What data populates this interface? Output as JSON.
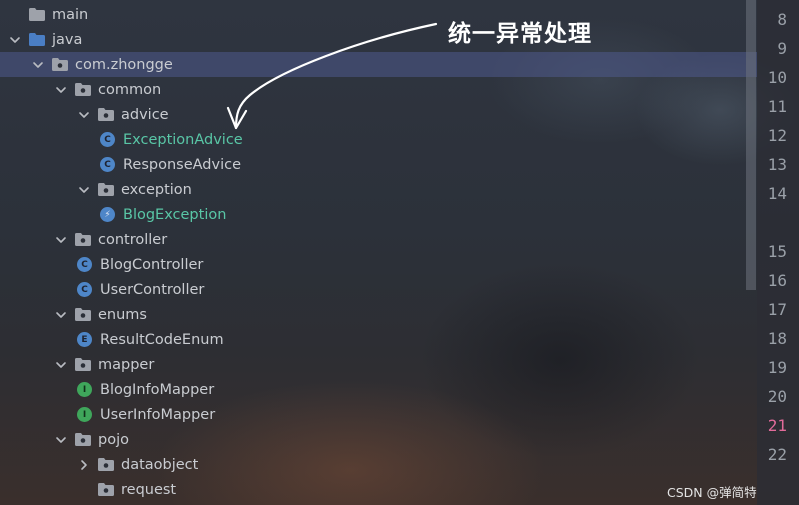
{
  "tree": [
    {
      "label": "main",
      "depth": 0,
      "icon": "folder",
      "arrow": "none",
      "kind": "folder"
    },
    {
      "label": "java",
      "depth": 0,
      "icon": "blue-folder",
      "arrow": "down",
      "kind": "folder"
    },
    {
      "label": "com.zhongge",
      "depth": 1,
      "icon": "package",
      "arrow": "down",
      "kind": "package",
      "selected": true
    },
    {
      "label": "common",
      "depth": 2,
      "icon": "package",
      "arrow": "down",
      "kind": "package"
    },
    {
      "label": "advice",
      "depth": 3,
      "icon": "package",
      "arrow": "down",
      "kind": "package"
    },
    {
      "label": "ExceptionAdvice",
      "depth": 4,
      "icon": "class",
      "kind": "class",
      "green": true
    },
    {
      "label": "ResponseAdvice",
      "depth": 4,
      "icon": "class",
      "kind": "class"
    },
    {
      "label": "exception",
      "depth": 3,
      "icon": "package",
      "arrow": "down",
      "kind": "package"
    },
    {
      "label": "BlogException",
      "depth": 4,
      "icon": "exception",
      "kind": "exception",
      "green": true
    },
    {
      "label": "controller",
      "depth": 2,
      "icon": "package",
      "arrow": "down",
      "kind": "package"
    },
    {
      "label": "BlogController",
      "depth": 3,
      "icon": "class",
      "kind": "class"
    },
    {
      "label": "UserController",
      "depth": 3,
      "icon": "class",
      "kind": "class"
    },
    {
      "label": "enums",
      "depth": 2,
      "icon": "package",
      "arrow": "down",
      "kind": "package"
    },
    {
      "label": "ResultCodeEnum",
      "depth": 3,
      "icon": "enum",
      "kind": "enum"
    },
    {
      "label": "mapper",
      "depth": 2,
      "icon": "package",
      "arrow": "down",
      "kind": "package"
    },
    {
      "label": "BlogInfoMapper",
      "depth": 3,
      "icon": "interface",
      "kind": "interface"
    },
    {
      "label": "UserInfoMapper",
      "depth": 3,
      "icon": "interface",
      "kind": "interface"
    },
    {
      "label": "pojo",
      "depth": 2,
      "icon": "package",
      "arrow": "down",
      "kind": "package"
    },
    {
      "label": "dataobject",
      "depth": 3,
      "icon": "package",
      "arrow": "right",
      "kind": "package"
    },
    {
      "label": "request",
      "depth": 3,
      "icon": "package",
      "arrow": "none",
      "kind": "package"
    }
  ],
  "line_numbers": [
    {
      "n": "8"
    },
    {
      "n": "9"
    },
    {
      "n": "10"
    },
    {
      "n": "11"
    },
    {
      "n": "12"
    },
    {
      "n": "13"
    },
    {
      "n": "14"
    },
    {
      "n": "15"
    },
    {
      "n": "16"
    },
    {
      "n": "17"
    },
    {
      "n": "18"
    },
    {
      "n": "19"
    },
    {
      "n": "20"
    },
    {
      "n": "21",
      "hl": true
    },
    {
      "n": "22"
    }
  ],
  "annotation": "统一异常处理",
  "watermark": "CSDN @弹简特",
  "colors": {
    "selected_row": "#4e598c",
    "green_label": "#59c6a6",
    "highlight_line": "#e16b9a"
  }
}
